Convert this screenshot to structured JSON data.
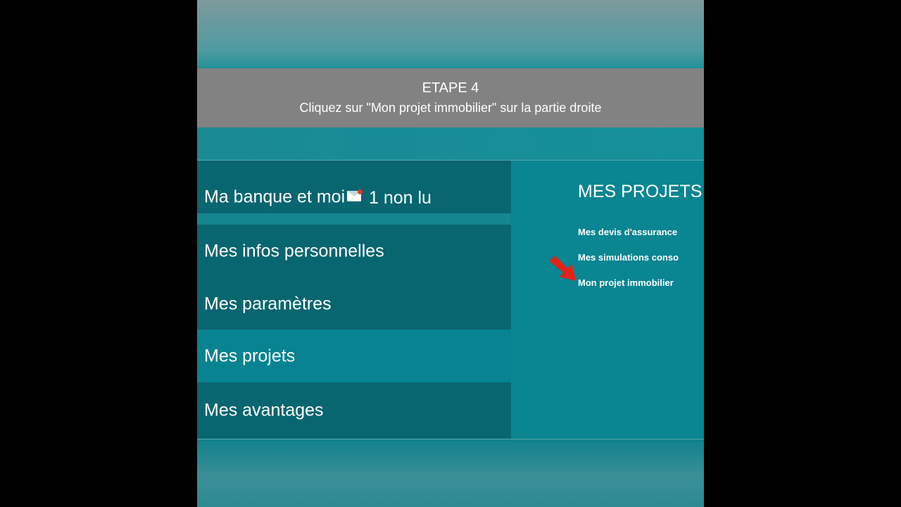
{
  "banner": {
    "step": "ETAPE 4",
    "instruction": "Cliquez sur \"Mon projet immobilier\" sur la partie droite"
  },
  "menu": {
    "items": [
      {
        "label": "Ma banque et moi",
        "unread": "1 non lu"
      },
      {
        "label": "Mes infos personnelles"
      },
      {
        "label": "Mes paramètres"
      },
      {
        "label": "Mes projets",
        "active": true
      },
      {
        "label": "Mes avantages"
      }
    ],
    "icons": {
      "mail": "envelope-icon",
      "badge": "notification-dot"
    }
  },
  "side": {
    "title": "MES PROJETS",
    "links": [
      "Mes devis d'assurance",
      "Mes simulations conso",
      "Mon projet immobilier"
    ],
    "pointer_icon": "red-arrow-icon"
  },
  "colors": {
    "banner_bg": "#828282",
    "menu_bg": "#086670",
    "menu_active_bg": "#078391",
    "side_bg": "#0a8592",
    "arrow": "#e02418",
    "badge": "#e23a2a"
  }
}
